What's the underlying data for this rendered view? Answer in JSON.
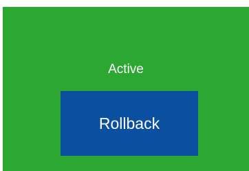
{
  "status": {
    "label": "Active",
    "panel_color": "#2ca832"
  },
  "actions": {
    "rollback_label": "Rollback",
    "rollback_color": "#0a4fa0"
  }
}
